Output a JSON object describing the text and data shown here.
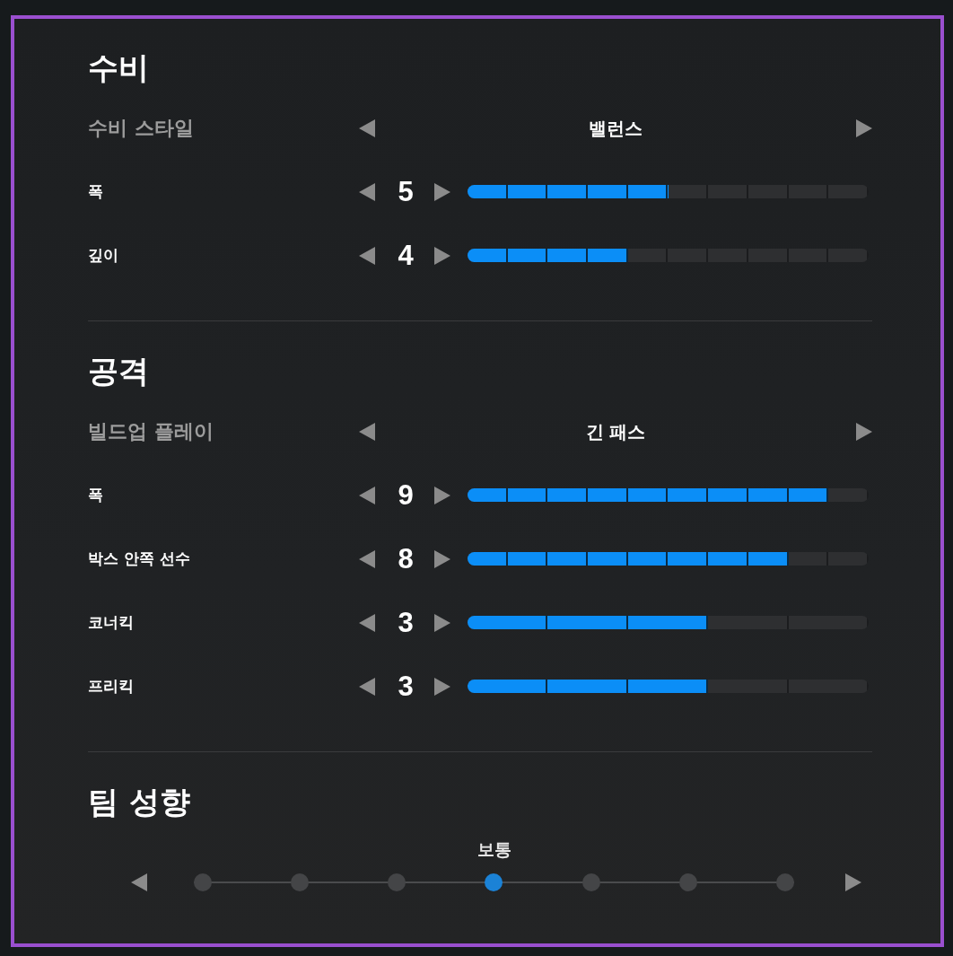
{
  "sections": [
    {
      "kind": "settings",
      "title": "수비",
      "choice": {
        "label": "수비 스타일",
        "value": "밸런스"
      },
      "sliders": [
        {
          "label": "폭",
          "value": "5",
          "level": 0.5,
          "kind": "fine"
        },
        {
          "label": "깊이",
          "value": "4",
          "level": 0.4,
          "kind": "fine"
        }
      ]
    },
    {
      "kind": "settings",
      "title": "공격",
      "choice": {
        "label": "빌드업 플레이",
        "value": "긴 패스"
      },
      "sliders": [
        {
          "label": "폭",
          "value": "9",
          "level": 0.9,
          "kind": "fine"
        },
        {
          "label": "박스 안쪽 선수",
          "value": "8",
          "level": 0.8,
          "kind": "fine"
        },
        {
          "label": "코너킥",
          "value": "3",
          "level": 0.6,
          "kind": "coarse"
        },
        {
          "label": "프리킥",
          "value": "3",
          "level": 0.6,
          "kind": "coarse"
        }
      ]
    },
    {
      "kind": "scale",
      "title": "팀 성향",
      "value": "보통",
      "steps": [
        {
          "selected": false
        },
        {
          "selected": false
        },
        {
          "selected": false
        },
        {
          "selected": true
        },
        {
          "selected": false
        },
        {
          "selected": false
        },
        {
          "selected": false
        }
      ]
    }
  ]
}
